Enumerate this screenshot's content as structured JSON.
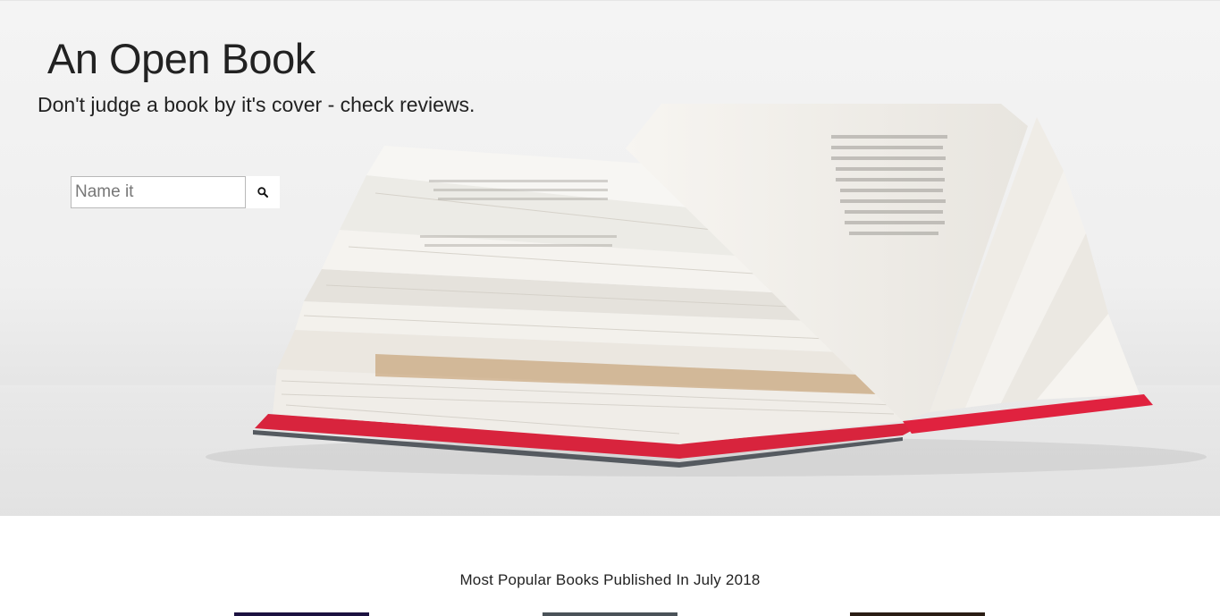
{
  "site": {
    "title": "An Open Book",
    "tagline": "Don't judge a book by it's cover - check reviews."
  },
  "search": {
    "placeholder": "Name it",
    "value": "",
    "button_icon": "search-icon"
  },
  "hero_image": {
    "subject": "open-book-photo",
    "accent_color": "#e0223f"
  },
  "popular": {
    "heading": "Most Popular Books Published In July 2018",
    "thumbnail_colors": [
      "#1b1140",
      "#4a5258",
      "#2a1d14"
    ]
  }
}
